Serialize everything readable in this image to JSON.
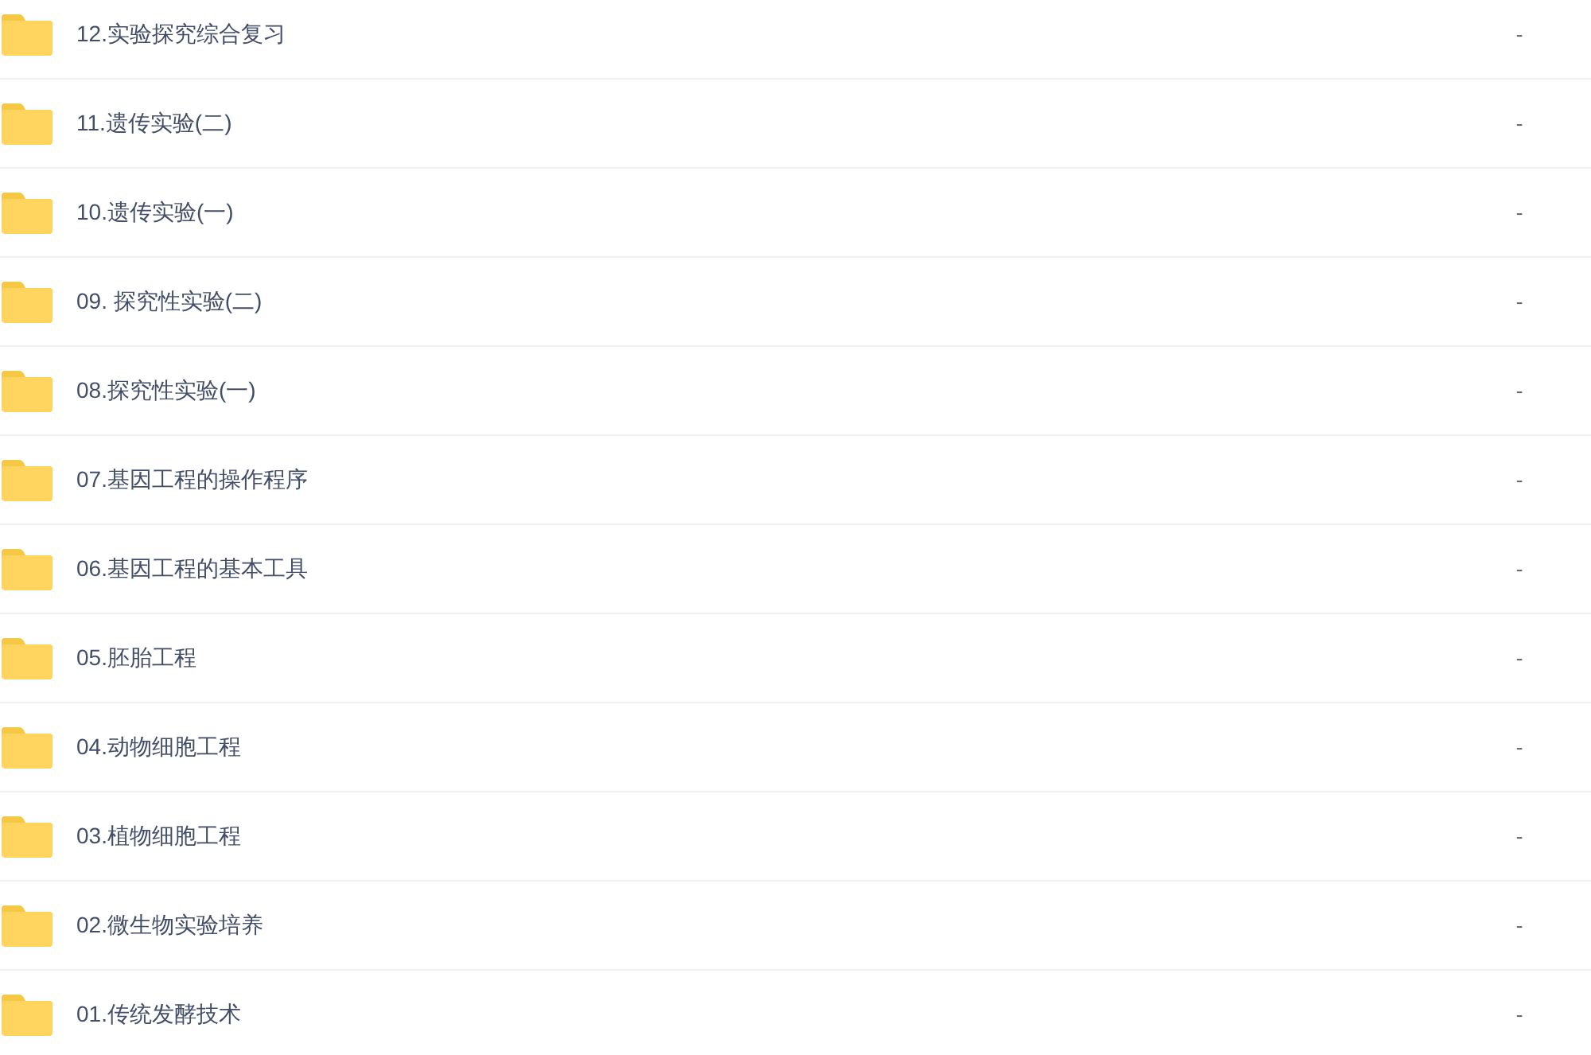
{
  "files": [
    {
      "name": "12.实验探究综合复习",
      "column_2": "-"
    },
    {
      "name": "11.遗传实验(二)",
      "column_2": "-"
    },
    {
      "name": "10.遗传实验(一)",
      "column_2": "-"
    },
    {
      "name": "09. 探究性实验(二)",
      "column_2": "-"
    },
    {
      "name": "08.探究性实验(一)",
      "column_2": "-"
    },
    {
      "name": "07.基因工程的操作程序",
      "column_2": "-"
    },
    {
      "name": "06.基因工程的基本工具",
      "column_2": "-"
    },
    {
      "name": "05.胚胎工程",
      "column_2": "-"
    },
    {
      "name": "04.动物细胞工程",
      "column_2": "-"
    },
    {
      "name": "03.植物细胞工程",
      "column_2": "-"
    },
    {
      "name": "02.微生物实验培养",
      "column_2": "-"
    },
    {
      "name": "01.传统发酵技术",
      "column_2": "-"
    }
  ]
}
